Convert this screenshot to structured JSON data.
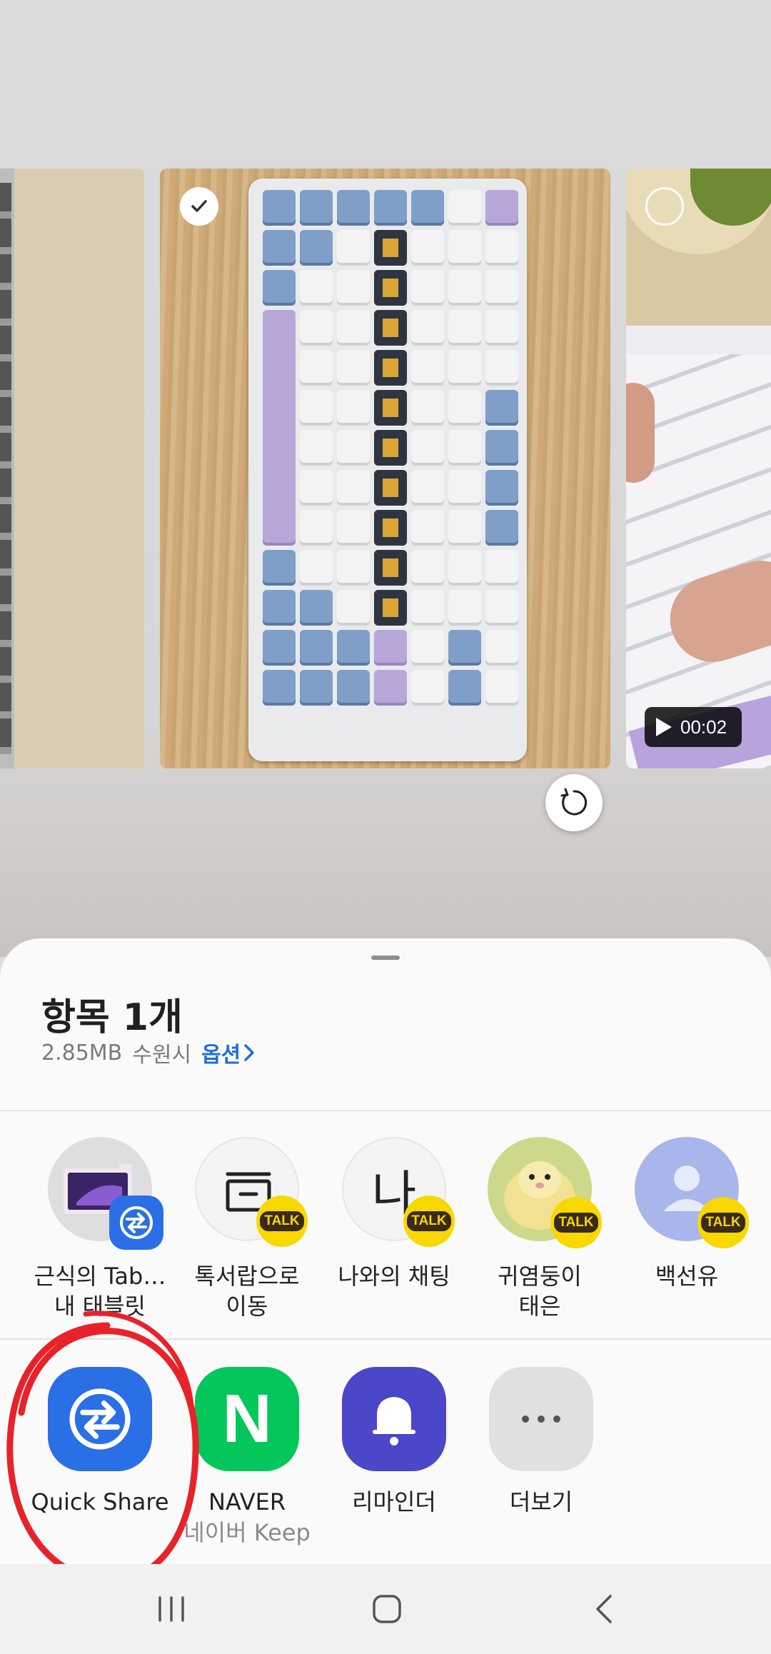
{
  "sheet": {
    "title": "항목 1개",
    "size": "2.85MB",
    "location": "수원시",
    "options_label": "옵션"
  },
  "preview": {
    "video_duration": "00:02"
  },
  "direct_targets": [
    {
      "line1": "근식의 Tab…",
      "line2": "내 태블릿",
      "icon": "tablet-device-icon",
      "badge": "quick-share-badge"
    },
    {
      "line1": "톡서랍으로",
      "line2": "이동",
      "icon": "drawer-icon",
      "badge": "kakaotalk-badge"
    },
    {
      "line1": "나와의 채팅",
      "line2": "",
      "icon": "na-chat-icon",
      "icon_text": "나",
      "badge": "kakaotalk-badge"
    },
    {
      "line1": "귀염둥이",
      "line2": "태은",
      "icon": "hamster-avatar",
      "badge": "kakaotalk-badge"
    },
    {
      "line1": "백선유",
      "line2": "",
      "icon": "person-avatar-icon",
      "badge": "kakaotalk-badge"
    }
  ],
  "talk_badge_text": "TALK",
  "apps": [
    {
      "label": "Quick Share",
      "sub": "",
      "icon": "quick-share-icon",
      "color": "#2a6fe6"
    },
    {
      "label": "NAVER",
      "sub": "네이버 Keep",
      "icon": "naver-icon",
      "icon_text": "N",
      "color": "#03c75a"
    },
    {
      "label": "리마인더",
      "sub": "",
      "icon": "bell-icon",
      "color": "#4b47c9"
    },
    {
      "label": "더보기",
      "sub": "",
      "icon": "more-icon",
      "color": "#e0e0e0"
    }
  ],
  "annotation": {
    "color": "#e8222a"
  }
}
